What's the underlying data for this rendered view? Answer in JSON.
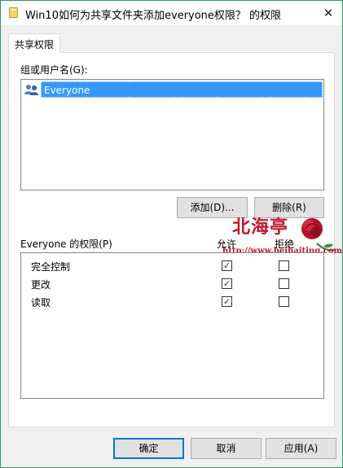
{
  "window": {
    "title": "Win10如何为共享文件夹添加everyone权限？ 的权限",
    "close_glyph": "✕"
  },
  "tab": {
    "label": "共享权限"
  },
  "users": {
    "label": "组或用户名(G):",
    "items": [
      {
        "name": "Everyone",
        "selected": true
      }
    ]
  },
  "buttons": {
    "add": "添加(D)...",
    "remove": "删除(R)",
    "ok": "确定",
    "cancel": "取消",
    "apply": "应用(A)"
  },
  "permissions": {
    "label": "Everyone 的权限(P)",
    "col_allow": "允许",
    "col_deny": "拒绝",
    "rows": [
      {
        "name": "完全控制",
        "allow": true,
        "deny": false
      },
      {
        "name": "更改",
        "allow": true,
        "deny": false
      },
      {
        "name": "读取",
        "allow": true,
        "deny": false
      }
    ]
  },
  "watermark": {
    "text": "北海亭",
    "url": "http://www.beihaiting.com"
  },
  "check_glyph": "✓"
}
